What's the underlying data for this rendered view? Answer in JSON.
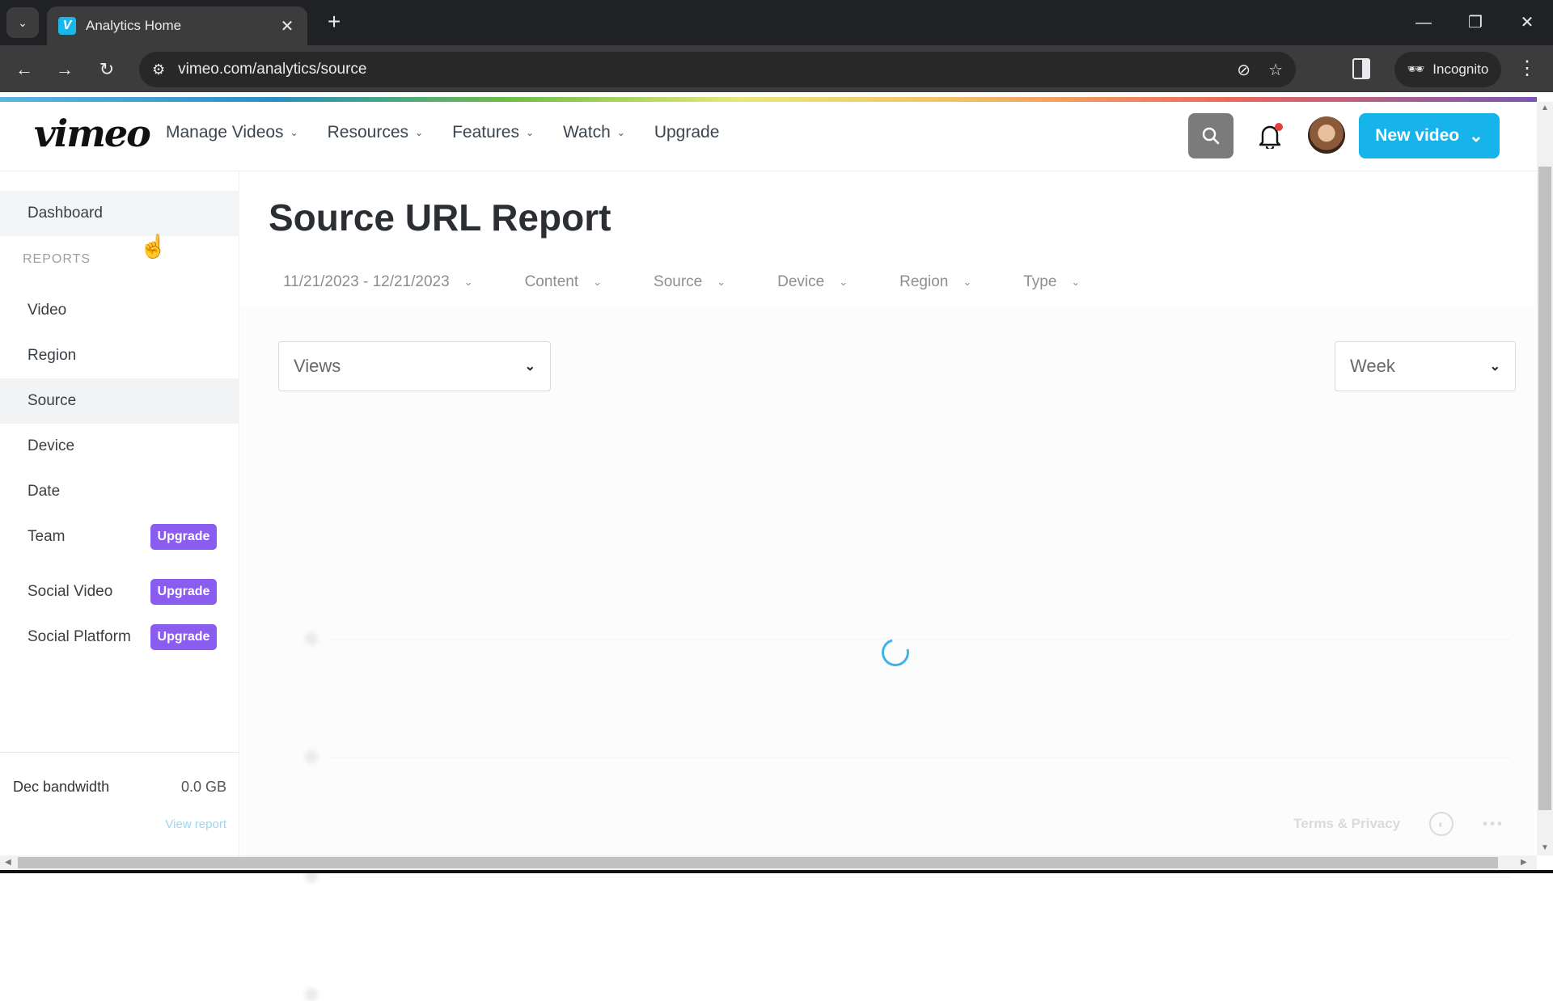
{
  "browser": {
    "tab_title": "Analytics Home",
    "tab_favicon": "V",
    "url": "vimeo.com/analytics/source",
    "incognito_label": "Incognito",
    "icons": {
      "tab_search": "chevron-down-icon",
      "tab_close": "close-icon",
      "new_tab": "plus-icon",
      "back": "arrow-left-icon",
      "forward": "arrow-right-icon",
      "reload": "reload-icon",
      "site_settings": "tune-icon",
      "tracking": "eye-off-icon",
      "bookmark": "star-icon",
      "side_panel": "side-panel-icon",
      "menu": "more-vertical-icon"
    }
  },
  "header": {
    "logo": "vimeo",
    "nav": [
      {
        "label": "Manage Videos",
        "has_dropdown": true
      },
      {
        "label": "Resources",
        "has_dropdown": true
      },
      {
        "label": "Features",
        "has_dropdown": true
      },
      {
        "label": "Watch",
        "has_dropdown": true
      },
      {
        "label": "Upgrade",
        "has_dropdown": false
      }
    ],
    "new_video_label": "New video",
    "has_notification": true,
    "colors": {
      "accent": "#17b4ec",
      "notification": "#e0413b"
    }
  },
  "sidebar": {
    "dashboard_label": "Dashboard",
    "reports_heading": "REPORTS",
    "items": [
      {
        "label": "Video"
      },
      {
        "label": "Region"
      },
      {
        "label": "Source",
        "active": true
      },
      {
        "label": "Device"
      },
      {
        "label": "Date"
      },
      {
        "label": "Team",
        "badge": "Upgrade"
      },
      {
        "label": "Social Video",
        "badge": "Upgrade"
      },
      {
        "label": "Social Platform",
        "badge": "Upgrade"
      }
    ],
    "badge_color": "#8b5cf0",
    "bandwidth_label": "Dec bandwidth",
    "bandwidth_value": "0.0 GB",
    "view_report_label": "View report"
  },
  "main": {
    "title": "Source URL Report",
    "filters": [
      {
        "label": "11/21/2023 - 12/21/2023"
      },
      {
        "label": "Content"
      },
      {
        "label": "Source"
      },
      {
        "label": "Device"
      },
      {
        "label": "Region"
      },
      {
        "label": "Type"
      }
    ],
    "metric_select": "Views",
    "interval_select": "Week",
    "loading": true,
    "footer": {
      "terms_label": "Terms & Privacy",
      "more_label": "•••"
    }
  }
}
